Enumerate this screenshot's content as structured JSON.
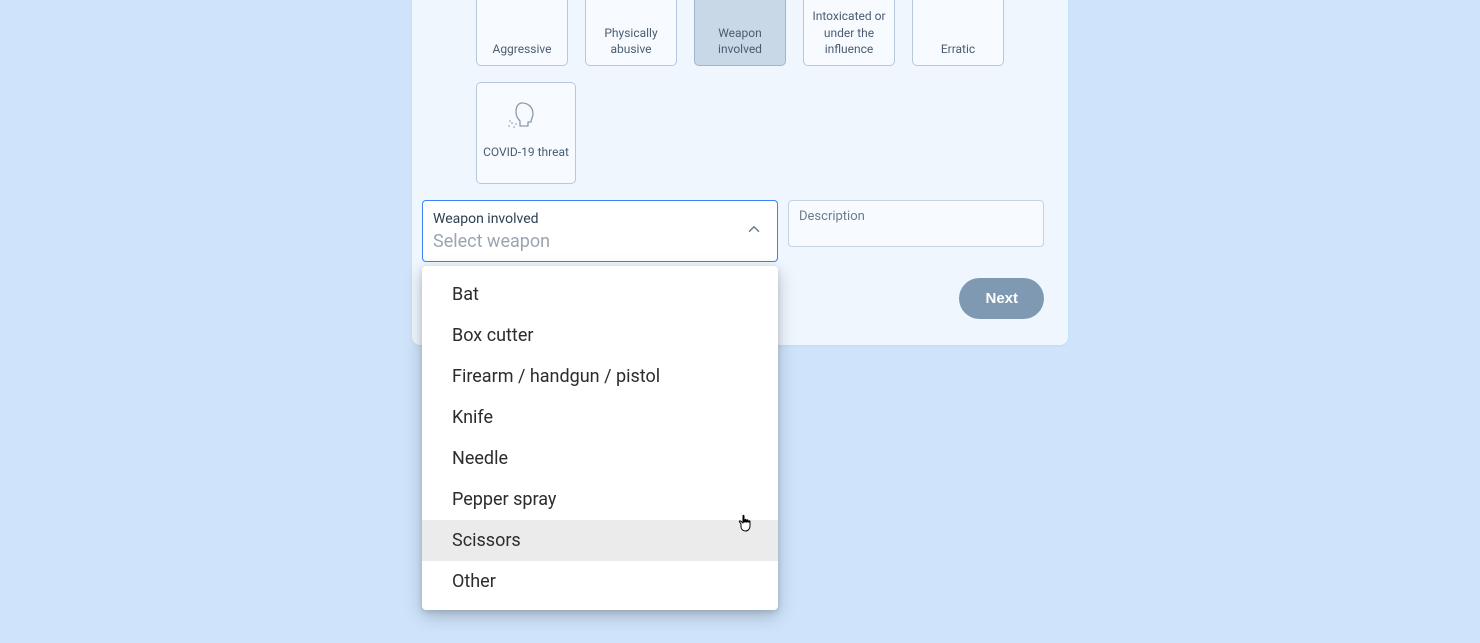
{
  "behavior": {
    "tiles_row1": [
      {
        "label": "Aggressive",
        "selected": false
      },
      {
        "label": "Physically abusive",
        "selected": false
      },
      {
        "label": "Weapon involved",
        "selected": true
      },
      {
        "label": "Intoxicated or under the influence",
        "selected": false
      },
      {
        "label": "Erratic",
        "selected": false
      }
    ],
    "tiles_row2": [
      {
        "label": "COVID-19 threat",
        "selected": false
      }
    ]
  },
  "form": {
    "weapon_select": {
      "label": "Weapon involved",
      "placeholder": "Select weapon",
      "options": [
        "Bat",
        "Box cutter",
        "Firearm / handgun / pistol",
        "Knife",
        "Needle",
        "Pepper spray",
        "Scissors",
        "Other"
      ],
      "highlighted_index": 6
    },
    "description": {
      "label": "Description"
    }
  },
  "buttons": {
    "next": "Next"
  }
}
